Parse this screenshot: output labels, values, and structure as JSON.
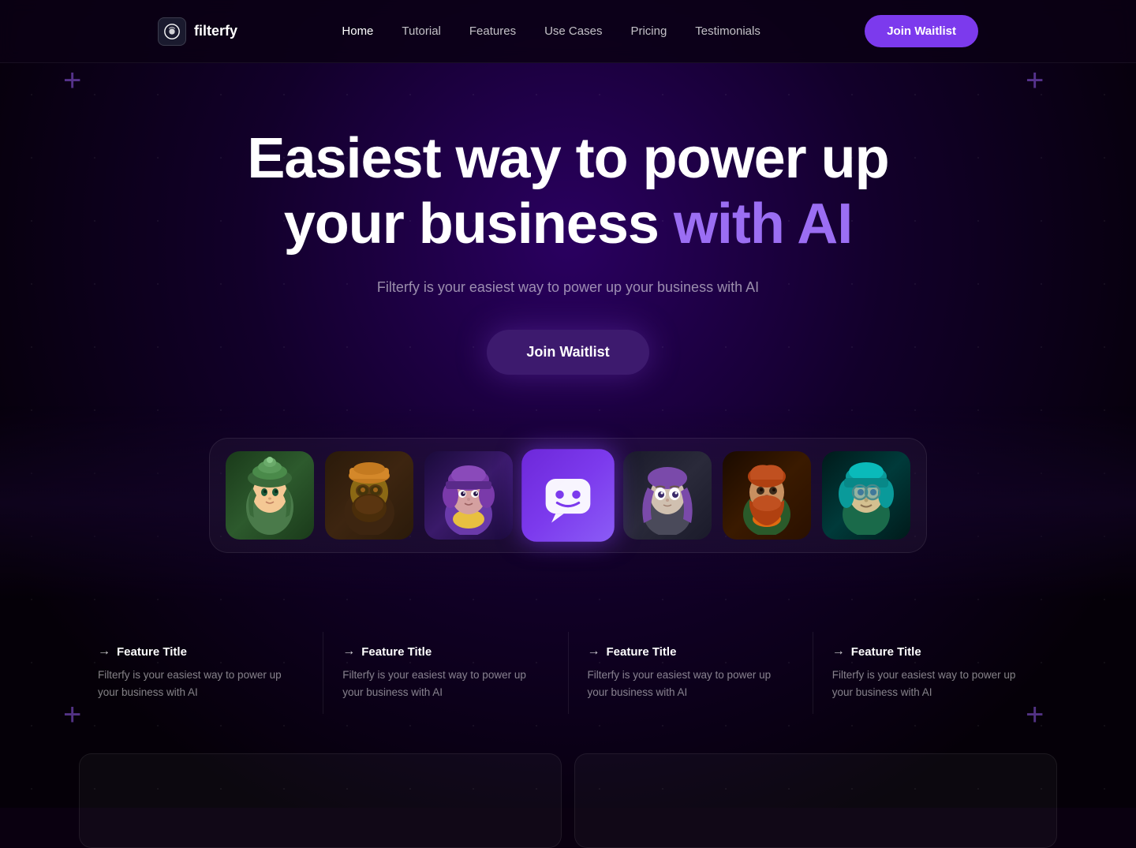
{
  "brand": {
    "name": "filterfy",
    "logo_icon": "filterfy-logo"
  },
  "nav": {
    "links": [
      {
        "id": "home",
        "label": "Home",
        "active": true
      },
      {
        "id": "tutorial",
        "label": "Tutorial",
        "active": false
      },
      {
        "id": "features",
        "label": "Features",
        "active": false
      },
      {
        "id": "use-cases",
        "label": "Use Cases",
        "active": false
      },
      {
        "id": "pricing",
        "label": "Pricing",
        "active": false
      },
      {
        "id": "testimonials",
        "label": "Testimonials",
        "active": false
      }
    ],
    "cta_label": "Join Waitlist"
  },
  "hero": {
    "title_part1": "Easiest way to power up",
    "title_part2": "your business ",
    "title_accent": "with AI",
    "subtitle": "Filterfy is your easiest way to power up your business with AI",
    "cta_label": "Join Waitlist"
  },
  "avatars": [
    {
      "id": "avatar-1",
      "label": "Green character",
      "emoji": "🧑"
    },
    {
      "id": "avatar-2",
      "label": "Brown bearded character",
      "emoji": "🧔"
    },
    {
      "id": "avatar-3",
      "label": "Purple hair character",
      "emoji": "👩"
    },
    {
      "id": "avatar-center",
      "label": "Filterfy logo",
      "is_logo": true
    },
    {
      "id": "avatar-5",
      "label": "Gray character",
      "emoji": "🧑"
    },
    {
      "id": "avatar-6",
      "label": "Orange bearded character",
      "emoji": "🧔"
    },
    {
      "id": "avatar-7",
      "label": "Teal character",
      "emoji": "👩"
    }
  ],
  "features": [
    {
      "id": "feature-1",
      "title": "Feature Title",
      "description": "Filterfy is your easiest way to power up your business with AI"
    },
    {
      "id": "feature-2",
      "title": "Feature Title",
      "description": "Filterfy is your easiest way to power up your business with AI"
    },
    {
      "id": "feature-3",
      "title": "Feature Title",
      "description": "Filterfy is your easiest way to power up your business with AI"
    },
    {
      "id": "feature-4",
      "title": "Feature Title",
      "description": "Filterfy is your easiest way to power up your business with AI"
    }
  ],
  "colors": {
    "accent": "#7c3aed",
    "accent_light": "#9b6ef3",
    "background": "#0a0010"
  }
}
